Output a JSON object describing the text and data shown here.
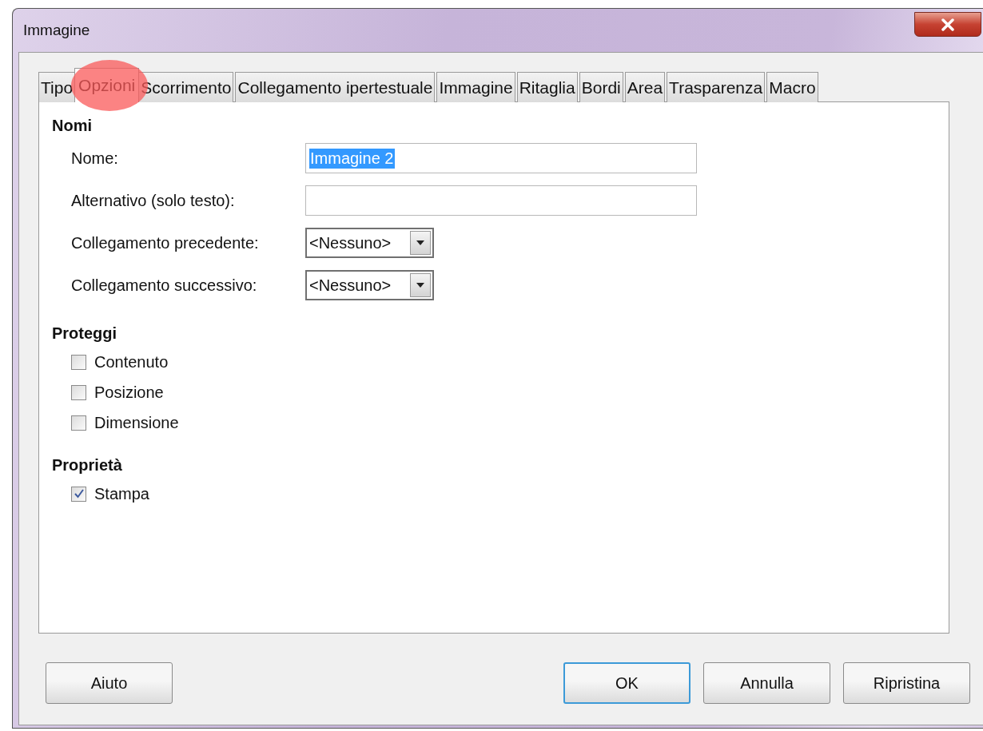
{
  "window": {
    "title": "Immagine"
  },
  "tabs": [
    {
      "label": "Tipo",
      "selected": false,
      "circled": false
    },
    {
      "label": "Opzioni",
      "selected": true,
      "circled": true
    },
    {
      "label": "Scorrimento",
      "selected": false,
      "circled": false
    },
    {
      "label": "Collegamento ipertestuale",
      "selected": false,
      "circled": false
    },
    {
      "label": "Immagine",
      "selected": false,
      "circled": false
    },
    {
      "label": "Ritaglia",
      "selected": false,
      "circled": false
    },
    {
      "label": "Bordi",
      "selected": false,
      "circled": false
    },
    {
      "label": "Area",
      "selected": false,
      "circled": false
    },
    {
      "label": "Trasparenza",
      "selected": false,
      "circled": false
    },
    {
      "label": "Macro",
      "selected": false,
      "circled": false
    }
  ],
  "sections": [
    {
      "heading": "Nomi",
      "kind": "fields",
      "items": [
        {
          "kind": "text",
          "label": "Nome:",
          "value": "Immagine 2",
          "selected": true
        },
        {
          "kind": "text",
          "label": "Alternativo (solo testo):"
        },
        {
          "kind": "dropdown",
          "label": "Collegamento precedente:",
          "value": "<Nessuno>"
        },
        {
          "kind": "dropdown",
          "label": "Collegamento successivo:",
          "value": "<Nessuno>"
        }
      ]
    },
    {
      "heading": "Proteggi",
      "kind": "checks",
      "items": [
        {
          "label": "Contenuto",
          "checked": false
        },
        {
          "label": "Posizione",
          "checked": false
        },
        {
          "label": "Dimensione",
          "checked": false
        }
      ]
    },
    {
      "heading": "Proprietà",
      "kind": "checks",
      "items": [
        {
          "label": "Stampa",
          "checked": true
        }
      ]
    }
  ],
  "left_buttons": [
    {
      "label": "Aiuto",
      "default": false
    }
  ],
  "right_buttons": [
    {
      "label": "OK",
      "default": true
    },
    {
      "label": "Annulla",
      "default": false
    },
    {
      "label": "Ripristina",
      "default": false
    }
  ]
}
